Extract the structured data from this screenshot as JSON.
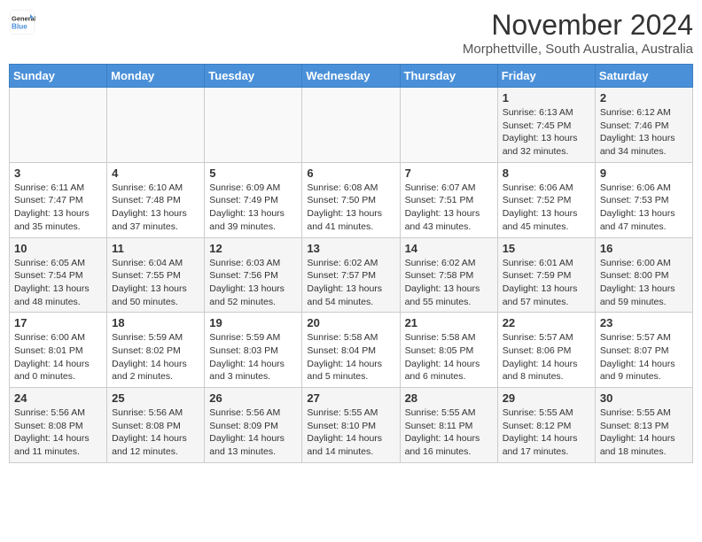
{
  "header": {
    "logo_line1": "General",
    "logo_line2": "Blue",
    "month": "November 2024",
    "location": "Morphettville, South Australia, Australia"
  },
  "weekdays": [
    "Sunday",
    "Monday",
    "Tuesday",
    "Wednesday",
    "Thursday",
    "Friday",
    "Saturday"
  ],
  "weeks": [
    [
      {
        "day": "",
        "info": ""
      },
      {
        "day": "",
        "info": ""
      },
      {
        "day": "",
        "info": ""
      },
      {
        "day": "",
        "info": ""
      },
      {
        "day": "",
        "info": ""
      },
      {
        "day": "1",
        "info": "Sunrise: 6:13 AM\nSunset: 7:45 PM\nDaylight: 13 hours\nand 32 minutes."
      },
      {
        "day": "2",
        "info": "Sunrise: 6:12 AM\nSunset: 7:46 PM\nDaylight: 13 hours\nand 34 minutes."
      }
    ],
    [
      {
        "day": "3",
        "info": "Sunrise: 6:11 AM\nSunset: 7:47 PM\nDaylight: 13 hours\nand 35 minutes."
      },
      {
        "day": "4",
        "info": "Sunrise: 6:10 AM\nSunset: 7:48 PM\nDaylight: 13 hours\nand 37 minutes."
      },
      {
        "day": "5",
        "info": "Sunrise: 6:09 AM\nSunset: 7:49 PM\nDaylight: 13 hours\nand 39 minutes."
      },
      {
        "day": "6",
        "info": "Sunrise: 6:08 AM\nSunset: 7:50 PM\nDaylight: 13 hours\nand 41 minutes."
      },
      {
        "day": "7",
        "info": "Sunrise: 6:07 AM\nSunset: 7:51 PM\nDaylight: 13 hours\nand 43 minutes."
      },
      {
        "day": "8",
        "info": "Sunrise: 6:06 AM\nSunset: 7:52 PM\nDaylight: 13 hours\nand 45 minutes."
      },
      {
        "day": "9",
        "info": "Sunrise: 6:06 AM\nSunset: 7:53 PM\nDaylight: 13 hours\nand 47 minutes."
      }
    ],
    [
      {
        "day": "10",
        "info": "Sunrise: 6:05 AM\nSunset: 7:54 PM\nDaylight: 13 hours\nand 48 minutes."
      },
      {
        "day": "11",
        "info": "Sunrise: 6:04 AM\nSunset: 7:55 PM\nDaylight: 13 hours\nand 50 minutes."
      },
      {
        "day": "12",
        "info": "Sunrise: 6:03 AM\nSunset: 7:56 PM\nDaylight: 13 hours\nand 52 minutes."
      },
      {
        "day": "13",
        "info": "Sunrise: 6:02 AM\nSunset: 7:57 PM\nDaylight: 13 hours\nand 54 minutes."
      },
      {
        "day": "14",
        "info": "Sunrise: 6:02 AM\nSunset: 7:58 PM\nDaylight: 13 hours\nand 55 minutes."
      },
      {
        "day": "15",
        "info": "Sunrise: 6:01 AM\nSunset: 7:59 PM\nDaylight: 13 hours\nand 57 minutes."
      },
      {
        "day": "16",
        "info": "Sunrise: 6:00 AM\nSunset: 8:00 PM\nDaylight: 13 hours\nand 59 minutes."
      }
    ],
    [
      {
        "day": "17",
        "info": "Sunrise: 6:00 AM\nSunset: 8:01 PM\nDaylight: 14 hours\nand 0 minutes."
      },
      {
        "day": "18",
        "info": "Sunrise: 5:59 AM\nSunset: 8:02 PM\nDaylight: 14 hours\nand 2 minutes."
      },
      {
        "day": "19",
        "info": "Sunrise: 5:59 AM\nSunset: 8:03 PM\nDaylight: 14 hours\nand 3 minutes."
      },
      {
        "day": "20",
        "info": "Sunrise: 5:58 AM\nSunset: 8:04 PM\nDaylight: 14 hours\nand 5 minutes."
      },
      {
        "day": "21",
        "info": "Sunrise: 5:58 AM\nSunset: 8:05 PM\nDaylight: 14 hours\nand 6 minutes."
      },
      {
        "day": "22",
        "info": "Sunrise: 5:57 AM\nSunset: 8:06 PM\nDaylight: 14 hours\nand 8 minutes."
      },
      {
        "day": "23",
        "info": "Sunrise: 5:57 AM\nSunset: 8:07 PM\nDaylight: 14 hours\nand 9 minutes."
      }
    ],
    [
      {
        "day": "24",
        "info": "Sunrise: 5:56 AM\nSunset: 8:08 PM\nDaylight: 14 hours\nand 11 minutes."
      },
      {
        "day": "25",
        "info": "Sunrise: 5:56 AM\nSunset: 8:08 PM\nDaylight: 14 hours\nand 12 minutes."
      },
      {
        "day": "26",
        "info": "Sunrise: 5:56 AM\nSunset: 8:09 PM\nDaylight: 14 hours\nand 13 minutes."
      },
      {
        "day": "27",
        "info": "Sunrise: 5:55 AM\nSunset: 8:10 PM\nDaylight: 14 hours\nand 14 minutes."
      },
      {
        "day": "28",
        "info": "Sunrise: 5:55 AM\nSunset: 8:11 PM\nDaylight: 14 hours\nand 16 minutes."
      },
      {
        "day": "29",
        "info": "Sunrise: 5:55 AM\nSunset: 8:12 PM\nDaylight: 14 hours\nand 17 minutes."
      },
      {
        "day": "30",
        "info": "Sunrise: 5:55 AM\nSunset: 8:13 PM\nDaylight: 14 hours\nand 18 minutes."
      }
    ]
  ]
}
